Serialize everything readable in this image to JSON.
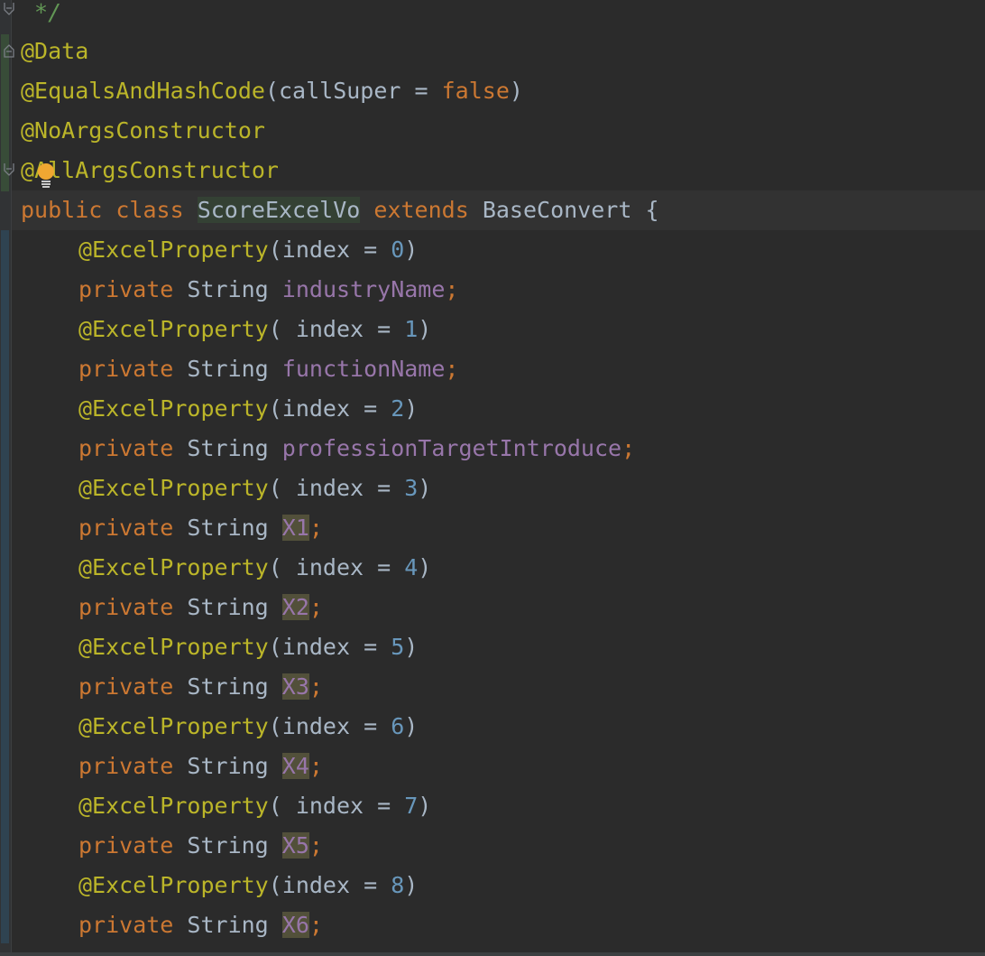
{
  "editor": {
    "theme_colors": {
      "background": "#2b2b2b",
      "annotation": "#bbb529",
      "keyword": "#cc7832",
      "number": "#6897bb",
      "field": "#9876aa",
      "comment": "#629755",
      "text": "#a9b7c6"
    },
    "lines": {
      "l0": {
        "comment": " */"
      },
      "l1": {
        "annotation": "@Data"
      },
      "l2": {
        "annotation": "@EqualsAndHashCode",
        "open": "(callSuper = ",
        "value": "false",
        "close": ")"
      },
      "l3": {
        "annotation": "@NoArgsConstructor"
      },
      "l4": {
        "annotation_a": "@",
        "annotation_b": "AllArgsConstructor"
      },
      "l5": {
        "kw1": "public",
        "kw2": "class",
        "class_name": "ScoreExcelVo",
        "kw3": "extends",
        "parent": "BaseConvert",
        "brace": "{"
      },
      "fields": [
        {
          "annotation": "@ExcelProperty",
          "args_prefix": "(index = ",
          "index": "0",
          "args_suffix": ")",
          "modifier": "private",
          "type": "String",
          "name": "industryName",
          "semicolon": ";"
        },
        {
          "annotation": "@ExcelProperty",
          "args_prefix": "( index = ",
          "index": "1",
          "args_suffix": ")",
          "modifier": "private",
          "type": "String",
          "name": "functionName",
          "semicolon": ";"
        },
        {
          "annotation": "@ExcelProperty",
          "args_prefix": "(index = ",
          "index": "2",
          "args_suffix": ")",
          "modifier": "private",
          "type": "String",
          "name": "professionTargetIntroduce",
          "semicolon": ";"
        },
        {
          "annotation": "@ExcelProperty",
          "args_prefix": "( index = ",
          "index": "3",
          "args_suffix": ")",
          "modifier": "private",
          "type": "String",
          "name": "X1",
          "semicolon": ";"
        },
        {
          "annotation": "@ExcelProperty",
          "args_prefix": "( index = ",
          "index": "4",
          "args_suffix": ")",
          "modifier": "private",
          "type": "String",
          "name": "X2",
          "semicolon": ";"
        },
        {
          "annotation": "@ExcelProperty",
          "args_prefix": "(index = ",
          "index": "5",
          "args_suffix": ")",
          "modifier": "private",
          "type": "String",
          "name": "X3",
          "semicolon": ";"
        },
        {
          "annotation": "@ExcelProperty",
          "args_prefix": "(index = ",
          "index": "6",
          "args_suffix": ")",
          "modifier": "private",
          "type": "String",
          "name": "X4",
          "semicolon": ";"
        },
        {
          "annotation": "@ExcelProperty",
          "args_prefix": "( index = ",
          "index": "7",
          "args_suffix": ")",
          "modifier": "private",
          "type": "String",
          "name": "X5",
          "semicolon": ";"
        },
        {
          "annotation": "@ExcelProperty",
          "args_prefix": "(index = ",
          "index": "8",
          "args_suffix": ")",
          "modifier": "private",
          "type": "String",
          "name": "X6",
          "semicolon": ";"
        }
      ]
    },
    "icons": {
      "fold_end": "fold-end-icon",
      "fold_start": "fold-start-icon",
      "intention_bulb": "lightbulb-icon"
    }
  }
}
